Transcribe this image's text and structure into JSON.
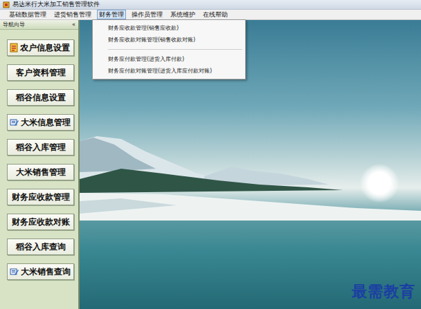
{
  "window": {
    "title": "易达米行大米加工销售管理软件"
  },
  "menu": [
    {
      "label": "基础数据管理",
      "selected": false
    },
    {
      "label": "进货销售管理",
      "selected": false
    },
    {
      "label": "财务管理",
      "selected": true
    },
    {
      "label": "操作员管理",
      "selected": false
    },
    {
      "label": "系统维护",
      "selected": false
    },
    {
      "label": "在线帮助",
      "selected": false
    }
  ],
  "dropdown": {
    "groups": [
      [
        "财务应收款管理(销售应收款)",
        "财务应收款对账管理(销售收款对账)"
      ],
      [
        "财务应付款管理(进货入库付款)",
        "财务应付款对账管理(进货入库应付款对账)"
      ]
    ]
  },
  "sidebar": {
    "title": "导航向导",
    "collapse": "«",
    "items": [
      {
        "label": "农户信息设置",
        "kind": "icon"
      },
      {
        "label": "客户资料管理",
        "kind": "text"
      },
      {
        "label": "稻谷信息设置",
        "kind": "text"
      },
      {
        "label": "大米信息管理",
        "kind": "icon"
      },
      {
        "label": "稻谷入库管理",
        "kind": "text"
      },
      {
        "label": "大米销售管理",
        "kind": "text"
      },
      {
        "label": "财务应收款管理",
        "kind": "text"
      },
      {
        "label": "财务应收款对账",
        "kind": "text"
      },
      {
        "label": "稻谷入库查询",
        "kind": "text"
      },
      {
        "label": "大米销售查询",
        "kind": "icon"
      }
    ]
  },
  "watermark": "最需教育"
}
